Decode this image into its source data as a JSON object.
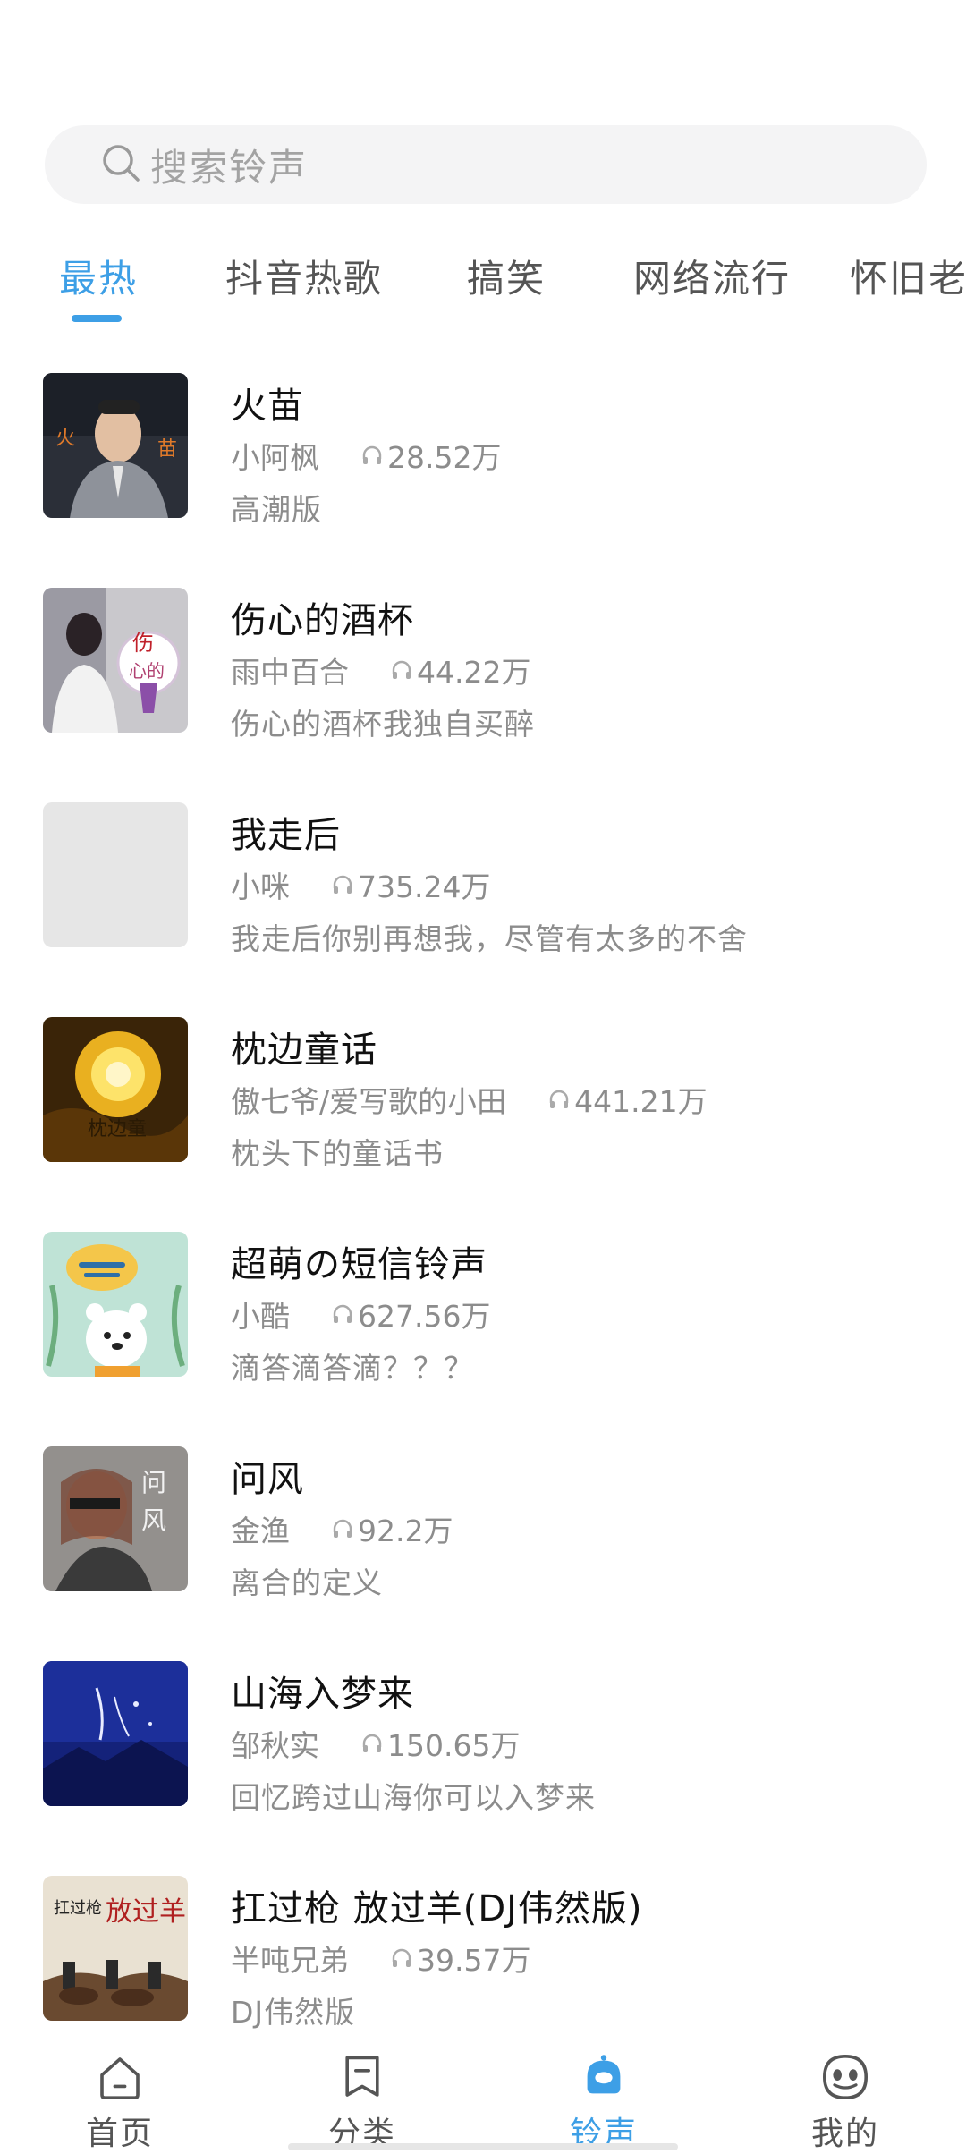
{
  "search": {
    "placeholder": "搜索铃声"
  },
  "tabs": [
    {
      "label": "最热",
      "active": true
    },
    {
      "label": "抖音热歌",
      "active": false
    },
    {
      "label": "搞笑",
      "active": false
    },
    {
      "label": "网络流行",
      "active": false
    },
    {
      "label": "怀旧老歌",
      "active": false
    }
  ],
  "ringtones": [
    {
      "title": "火苗",
      "artist": "小阿枫",
      "plays": "28.52万",
      "desc": "高潮版"
    },
    {
      "title": "伤心的酒杯",
      "artist": "雨中百合",
      "plays": "44.22万",
      "desc": "伤心的酒杯我独自买醉"
    },
    {
      "title": "我走后",
      "artist": "小咪",
      "plays": "735.24万",
      "desc": "我走后你别再想我，尽管有太多的不舍"
    },
    {
      "title": "枕边童话",
      "artist": "傲七爷/爱写歌的小田",
      "plays": "441.21万",
      "desc": "枕头下的童话书"
    },
    {
      "title": "超萌の短信铃声",
      "artist": "小酷",
      "plays": "627.56万",
      "desc": "滴答滴答滴？？？"
    },
    {
      "title": "问风",
      "artist": "金渔",
      "plays": "92.2万",
      "desc": "离合的定义"
    },
    {
      "title": "山海入梦来",
      "artist": "邹秋实",
      "plays": "150.65万",
      "desc": "回忆跨过山海你可以入梦来"
    },
    {
      "title": "扛过枪 放过羊(DJ伟然版)",
      "artist": "半吨兄弟",
      "plays": "39.57万",
      "desc": "DJ伟然版"
    }
  ],
  "bottom_nav": [
    {
      "label": "首页",
      "icon": "home-icon",
      "active": false
    },
    {
      "label": "分类",
      "icon": "bookmark-icon",
      "active": false
    },
    {
      "label": "铃声",
      "icon": "bell-icon",
      "active": true
    },
    {
      "label": "我的",
      "icon": "face-icon",
      "active": false
    }
  ],
  "colors": {
    "accent": "#3d9fe6",
    "secondary_text": "#8c8c8c",
    "search_bg": "#f4f4f5"
  }
}
